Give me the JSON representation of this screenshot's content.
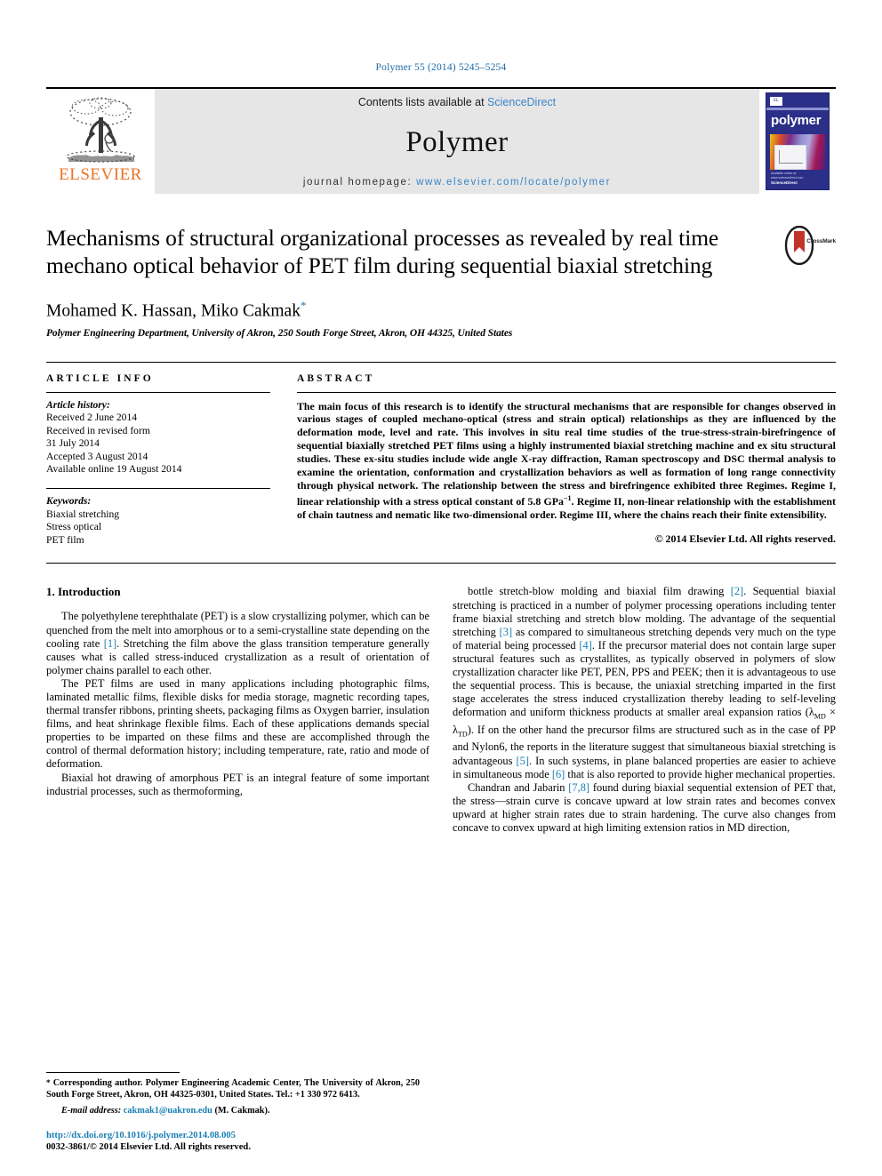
{
  "running_head": "Polymer 55 (2014) 5245–5254",
  "masthead": {
    "publisher": "ELSEVIER",
    "contents_prefix": "Contents lists available at ",
    "contents_link": "ScienceDirect",
    "journal_name": "Polymer",
    "homepage_prefix": "journal homepage: ",
    "homepage_url": "www.elsevier.com/locate/polymer",
    "cover_title": "polymer",
    "cover_badge": "EL",
    "cover_footer_line1": "Available online at www.sciencedirect.com",
    "cover_footer_line2": "ScienceDirect"
  },
  "article": {
    "title": "Mechanisms of structural organizational processes as revealed by real time mechano optical behavior of PET film during sequential biaxial stretching",
    "crossmark_label": "CrossMark",
    "authors": "Mohamed K. Hassan, Miko Cakmak",
    "author_star": "*",
    "affiliation": "Polymer Engineering Department, University of Akron, 250 South Forge Street, Akron, OH 44325, United States"
  },
  "article_info": {
    "heading": "ARTICLE INFO",
    "history_label": "Article history:",
    "history": [
      "Received 2 June 2014",
      "Received in revised form",
      "31 July 2014",
      "Accepted 3 August 2014",
      "Available online 19 August 2014"
    ],
    "keywords_label": "Keywords:",
    "keywords": [
      "Biaxial stretching",
      "Stress optical",
      "PET film"
    ]
  },
  "abstract": {
    "heading": "ABSTRACT",
    "text": "The main focus of this research is to identify the structural mechanisms that are responsible for changes observed in various stages of coupled mechano-optical (stress and strain optical) relationships as they are influenced by the deformation mode, level and rate. This involves in situ real time studies of the true-stress-strain-birefringence of sequential biaxially stretched PET films using a highly instrumented biaxial stretching machine and ex situ structural studies. These ex-situ studies include wide angle X-ray diffraction, Raman spectroscopy and DSC thermal analysis to examine the orientation, conformation and crystallization behaviors as well as formation of long range connectivity through physical network. The relationship between the stress and birefringence exhibited three Regimes. Regime I, linear relationship with a stress optical constant of 5.8 GPa",
    "text_sup": "−1",
    "text_after": ". Regime II, non-linear relationship with the establishment of chain tautness and nematic like two-dimensional order. Regime III, where the chains reach their finite extensibility.",
    "copyright": "© 2014 Elsevier Ltd. All rights reserved."
  },
  "introduction": {
    "heading": "1. Introduction",
    "left_p1_a": "The polyethylene terephthalate (PET) is a slow crystallizing polymer, which can be quenched from the melt into amorphous or to a semi-crystalline state depending on the cooling rate ",
    "left_p1_ref": "[1]",
    "left_p1_b": ". Stretching the film above the glass transition temperature generally causes what is called stress-induced crystallization as a result of orientation of polymer chains parallel to each other.",
    "left_p2": "The PET films are used in many applications including photographic films, laminated metallic films, flexible disks for media storage, magnetic recording tapes, thermal transfer ribbons, printing sheets, packaging films as Oxygen barrier, insulation films, and heat shrinkage flexible films. Each of these applications demands special properties to be imparted on these films and these are accomplished through the control of thermal deformation history; including temperature, rate, ratio and mode of deformation.",
    "left_p3": "Biaxial hot drawing of amorphous PET is an integral feature of some important industrial processes, such as thermoforming,",
    "right_p1_a": "bottle stretch-blow molding and biaxial film drawing ",
    "right_p1_ref1": "[2]",
    "right_p1_b": ". Sequential biaxial stretching is practiced in a number of polymer processing operations including tenter frame biaxial stretching and stretch blow molding. The advantage of the sequential stretching ",
    "right_p1_ref2": "[3]",
    "right_p1_c": " as compared to simultaneous stretching depends very much on the type of material being processed ",
    "right_p1_ref3": "[4]",
    "right_p1_d": ". If the precursor material does not contain large super structural features such as crystallites, as typically observed in polymers of slow crystallization character like PET, PEN, PPS and PEEK; then it is advantageous to use the sequential process. This is because, the uniaxial stretching imparted in the first stage accelerates the stress induced crystallization thereby leading to self-leveling deformation and uniform thickness products at smaller areal expansion ratios (λ",
    "right_p1_sub1": "MD",
    "right_p1_e": " × λ",
    "right_p1_sub2": "TD",
    "right_p1_f": "). If on the other hand the precursor films are structured such as in the case of PP and Nylon6, the reports in the literature suggest that simultaneous biaxial stretching is advantageous ",
    "right_p1_ref4": "[5]",
    "right_p1_g": ". In such systems, in plane balanced properties are easier to achieve in simultaneous mode ",
    "right_p1_ref5": "[6]",
    "right_p1_h": " that is also reported to provide higher mechanical properties.",
    "right_p2_a": "Chandran and Jabarin ",
    "right_p2_ref": "[7,8]",
    "right_p2_b": " found during biaxial sequential extension of PET that, the stress—strain curve is concave upward at low strain rates and becomes convex upward at higher strain rates due to strain hardening. The curve also changes from concave to convex upward at high limiting extension ratios in MD direction,"
  },
  "footnotes": {
    "corresponding_star": "*",
    "corresponding": " Corresponding author. Polymer Engineering Academic Center, The University of Akron, 250 South Forge Street, Akron, OH 44325-0301, United States. Tel.: +1 330 972 6413.",
    "email_label": "E-mail address:",
    "email": "cakmak1@uakron.edu",
    "email_suffix": " (M. Cakmak).",
    "doi": "http://dx.doi.org/10.1016/j.polymer.2014.08.005",
    "issn": "0032-3861/© 2014 Elsevier Ltd. All rights reserved."
  },
  "colors": {
    "link": "#1a7fb5",
    "elsevier_orange": "#ec7225",
    "band_gray": "#e6e6e6",
    "cover_blue": "#2b2f87"
  }
}
